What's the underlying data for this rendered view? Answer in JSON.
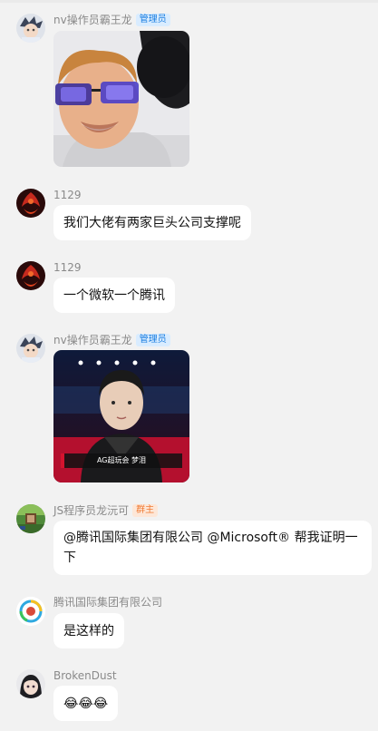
{
  "messages": [
    {
      "sender": "nv操作员霸王龙",
      "badge": "管理员",
      "type": "image",
      "image_caption": ""
    },
    {
      "sender": "1129",
      "badge": "",
      "type": "text",
      "text": "我们大佬有两家巨头公司支撑呢"
    },
    {
      "sender": "1129",
      "badge": "",
      "type": "text",
      "text": "一个微软一个腾讯"
    },
    {
      "sender": "nv操作员霸王龙",
      "badge": "管理员",
      "type": "image",
      "image_caption": "AG超玩会 梦泪"
    },
    {
      "sender": "JS程序员龙沅可",
      "badge": "群主",
      "type": "text",
      "text_line1": "@腾讯国际集团有限公司 @Microsoft® 帮我证明一",
      "text_line2": "下"
    },
    {
      "sender": "腾讯国际集团有限公司",
      "badge": "",
      "type": "text",
      "text": "是这样的"
    },
    {
      "sender": "BrokenDust",
      "badge": "",
      "type": "text",
      "text": "😂😂😂"
    }
  ],
  "colors": {
    "admin_badge": "#1d7fe0",
    "owner_badge": "#f07b35",
    "background": "#f2f2f2",
    "bubble": "#ffffff"
  }
}
